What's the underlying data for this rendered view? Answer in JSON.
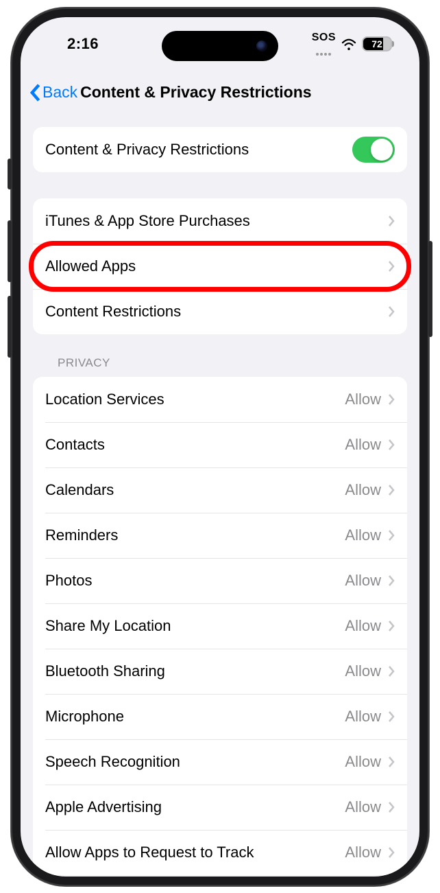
{
  "status": {
    "time": "2:16",
    "sos": "SOS",
    "battery": "72"
  },
  "nav": {
    "back": "Back",
    "title": "Content & Privacy Restrictions"
  },
  "main_toggle": {
    "label": "Content & Privacy Restrictions",
    "on": true
  },
  "group1": [
    {
      "label": "iTunes & App Store Purchases"
    },
    {
      "label": "Allowed Apps"
    },
    {
      "label": "Content Restrictions"
    }
  ],
  "privacy_header": "Privacy",
  "privacy_items": [
    {
      "label": "Location Services",
      "value": "Allow"
    },
    {
      "label": "Contacts",
      "value": "Allow"
    },
    {
      "label": "Calendars",
      "value": "Allow"
    },
    {
      "label": "Reminders",
      "value": "Allow"
    },
    {
      "label": "Photos",
      "value": "Allow"
    },
    {
      "label": "Share My Location",
      "value": "Allow"
    },
    {
      "label": "Bluetooth Sharing",
      "value": "Allow"
    },
    {
      "label": "Microphone",
      "value": "Allow"
    },
    {
      "label": "Speech Recognition",
      "value": "Allow"
    },
    {
      "label": "Apple Advertising",
      "value": "Allow"
    },
    {
      "label": "Allow Apps to Request to Track",
      "value": "Allow"
    }
  ],
  "highlight": {
    "target": "allowed-apps-row"
  }
}
